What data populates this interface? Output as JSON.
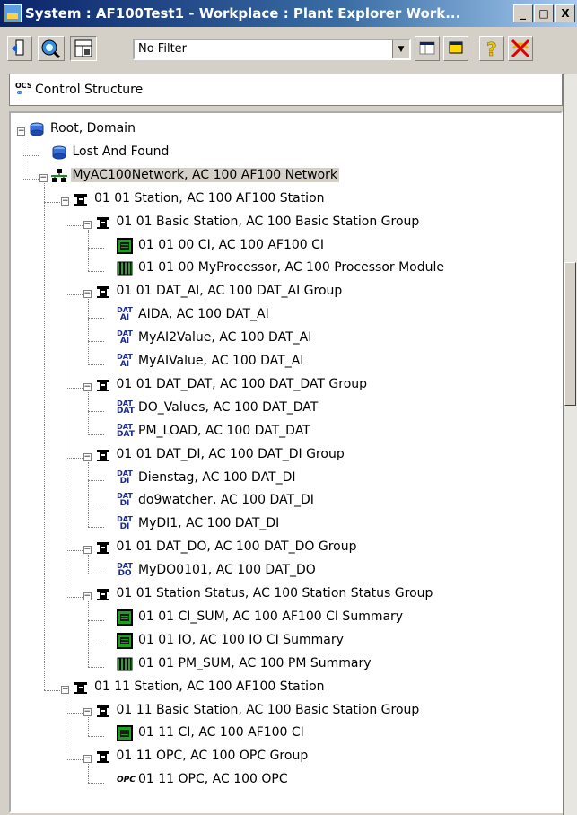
{
  "window": {
    "title": "System : AF100Test1 - Workplace : Plant Explorer Work..."
  },
  "title_buttons": {
    "minimize": "_",
    "maximize": "□",
    "close": "X"
  },
  "toolbar": {
    "filter_value": "No Filter"
  },
  "structure_selector": {
    "label": "Control Structure",
    "icon_text": "OCS"
  },
  "tree": [
    {
      "label": "Root, Domain",
      "level": 0,
      "icon": "domain-icon",
      "expander": "minus"
    },
    {
      "label": "Lost And Found",
      "level": 1,
      "icon": "domain-icon",
      "expander": null
    },
    {
      "label": "MyAC100Network, AC 100 AF100 Network",
      "level": 1,
      "icon": "network-icon",
      "expander": "minus",
      "selected": true
    },
    {
      "label": "01 01 Station, AC 100 AF100 Station",
      "level": 2,
      "icon": "station-icon",
      "expander": "minus"
    },
    {
      "label": "01 01 Basic Station, AC 100 Basic Station Group",
      "level": 3,
      "icon": "station-icon",
      "expander": "minus"
    },
    {
      "label": "01 01 00 CI, AC 100 AF100 CI",
      "level": 4,
      "icon": "ci-icon",
      "expander": null
    },
    {
      "label": "01 01 00 MyProcessor, AC 100 Processor Module",
      "level": 4,
      "icon": "processor-icon",
      "expander": null
    },
    {
      "label": "01 01 DAT_AI, AC 100 DAT_AI Group",
      "level": 3,
      "icon": "station-icon",
      "expander": "minus"
    },
    {
      "label": "AIDA, AC 100 DAT_AI",
      "level": 4,
      "icon": "dat-ai-icon",
      "icon_text": [
        "DAT",
        "AI"
      ],
      "expander": null
    },
    {
      "label": "MyAI2Value, AC 100 DAT_AI",
      "level": 4,
      "icon": "dat-ai-icon",
      "icon_text": [
        "DAT",
        "AI"
      ],
      "expander": null
    },
    {
      "label": "MyAIValue, AC 100 DAT_AI",
      "level": 4,
      "icon": "dat-ai-icon",
      "icon_text": [
        "DAT",
        "AI"
      ],
      "expander": null
    },
    {
      "label": "01 01 DAT_DAT, AC 100 DAT_DAT Group",
      "level": 3,
      "icon": "station-icon",
      "expander": "minus"
    },
    {
      "label": "DO_Values, AC 100 DAT_DAT",
      "level": 4,
      "icon": "dat-dat-icon",
      "icon_text": [
        "DAT",
        "DAT"
      ],
      "expander": null
    },
    {
      "label": "PM_LOAD, AC 100 DAT_DAT",
      "level": 4,
      "icon": "dat-dat-icon",
      "icon_text": [
        "DAT",
        "DAT"
      ],
      "expander": null
    },
    {
      "label": "01 01 DAT_DI, AC 100 DAT_DI Group",
      "level": 3,
      "icon": "station-icon",
      "expander": "minus"
    },
    {
      "label": "Dienstag, AC 100 DAT_DI",
      "level": 4,
      "icon": "dat-di-icon",
      "icon_text": [
        "DAT",
        "DI"
      ],
      "expander": null
    },
    {
      "label": "do9watcher, AC 100 DAT_DI",
      "level": 4,
      "icon": "dat-di-icon",
      "icon_text": [
        "DAT",
        "DI"
      ],
      "expander": null
    },
    {
      "label": "MyDI1, AC 100 DAT_DI",
      "level": 4,
      "icon": "dat-di-icon",
      "icon_text": [
        "DAT",
        "DI"
      ],
      "expander": null
    },
    {
      "label": "01 01 DAT_DO, AC 100 DAT_DO Group",
      "level": 3,
      "icon": "station-icon",
      "expander": "minus"
    },
    {
      "label": "MyDO0101, AC 100 DAT_DO",
      "level": 4,
      "icon": "dat-do-icon",
      "icon_text": [
        "DAT",
        "DO"
      ],
      "expander": null
    },
    {
      "label": "01 01 Station Status, AC 100 Station Status Group",
      "level": 3,
      "icon": "station-icon",
      "expander": "minus"
    },
    {
      "label": "01 01 CI_SUM, AC 100 AF100 CI Summary",
      "level": 4,
      "icon": "ci-icon",
      "expander": null
    },
    {
      "label": "01 01 IO, AC 100 IO CI Summary",
      "level": 4,
      "icon": "ci-icon",
      "expander": null
    },
    {
      "label": "01 01 PM_SUM, AC 100 PM Summary",
      "level": 4,
      "icon": "processor-icon",
      "expander": null
    },
    {
      "label": "01 11 Station, AC 100 AF100 Station",
      "level": 2,
      "icon": "station-icon",
      "expander": "minus"
    },
    {
      "label": "01 11 Basic Station, AC 100 Basic Station Group",
      "level": 3,
      "icon": "station-icon",
      "expander": "minus"
    },
    {
      "label": "01 11 CI, AC 100 AF100 CI",
      "level": 4,
      "icon": "ci-icon",
      "expander": null
    },
    {
      "label": "01 11 OPC, AC 100 OPC Group",
      "level": 3,
      "icon": "station-icon",
      "expander": "minus"
    },
    {
      "label": "01 11 OPC, AC 100 OPC",
      "level": 4,
      "icon": "opc-icon",
      "icon_text": [
        "OPC"
      ],
      "expander": null
    }
  ]
}
